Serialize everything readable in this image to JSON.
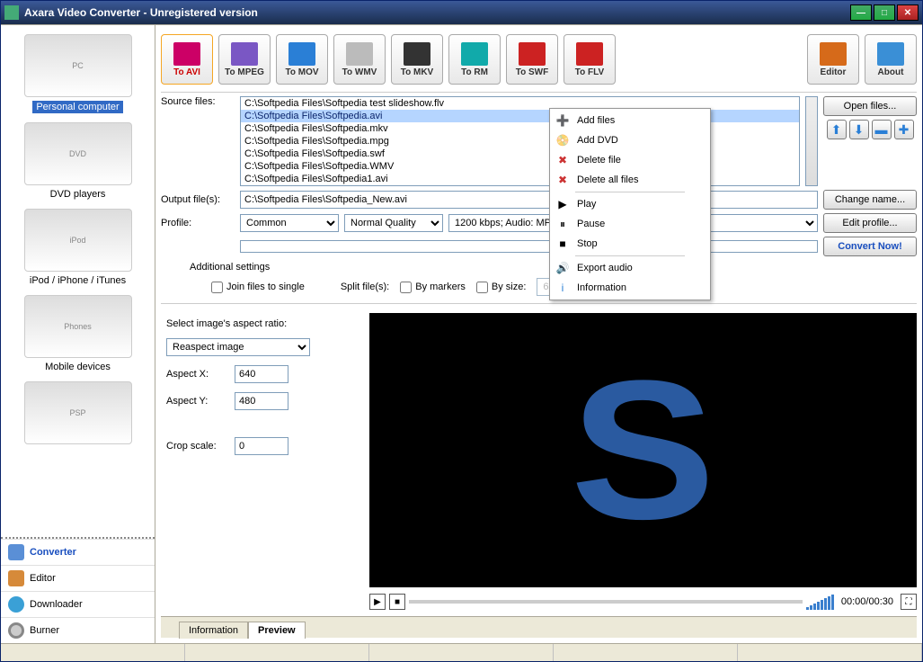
{
  "window": {
    "title": "Axara Video Converter - Unregistered version"
  },
  "devices": [
    {
      "label": "Personal computer",
      "hint": "PC",
      "selected": true
    },
    {
      "label": "DVD players",
      "hint": "DVD"
    },
    {
      "label": "iPod / iPhone / iTunes",
      "hint": "iPod"
    },
    {
      "label": "Mobile devices",
      "hint": "Phones"
    },
    {
      "label": "",
      "hint": "PSP"
    }
  ],
  "sidenav": [
    {
      "label": "Converter",
      "cls": "converter",
      "current": true
    },
    {
      "label": "Editor",
      "cls": "editor"
    },
    {
      "label": "Downloader",
      "cls": "downloader"
    },
    {
      "label": "Burner",
      "cls": "burner"
    }
  ],
  "toolbar": [
    {
      "label": "To AVI",
      "color": "#c06",
      "active": true
    },
    {
      "label": "To MPEG",
      "color": "#7a57c4"
    },
    {
      "label": "To MOV",
      "color": "#2a7fd6"
    },
    {
      "label": "To WMV",
      "color": "linear"
    },
    {
      "label": "To MKV",
      "color": "#333"
    },
    {
      "label": "To RM",
      "color": "#1aa"
    },
    {
      "label": "To SWF",
      "color": "#c22"
    },
    {
      "label": "To FLV",
      "color": "#c22"
    }
  ],
  "right_toolbar": [
    {
      "label": "Editor"
    },
    {
      "label": "About"
    }
  ],
  "labels": {
    "source_files": "Source files:",
    "output_files": "Output file(s):",
    "profile": "Profile:",
    "additional_settings": "Additional settings",
    "join": "Join files to single",
    "split": "Split file(s):",
    "by_markers": "By markers",
    "by_size": "By size:",
    "select_aspect": "Select image's aspect ratio:",
    "aspect_x": "Aspect X:",
    "aspect_y": "Aspect Y:",
    "crop_scale": "Crop scale:"
  },
  "files": [
    {
      "path": "C:\\Softpedia Files\\Softpedia test slideshow.flv"
    },
    {
      "path": "C:\\Softpedia Files\\Softpedia.avi",
      "selected": true
    },
    {
      "path": "C:\\Softpedia Files\\Softpedia.mkv"
    },
    {
      "path": "C:\\Softpedia Files\\Softpedia.mpg"
    },
    {
      "path": "C:\\Softpedia Files\\Softpedia.swf"
    },
    {
      "path": "C:\\Softpedia Files\\Softpedia.WMV"
    },
    {
      "path": "C:\\Softpedia Files\\Softpedia1.avi"
    }
  ],
  "output_file": "C:\\Softpedia Files\\Softpedia_New.avi",
  "profile": {
    "preset": "Common",
    "quality": "Normal Quality",
    "codec": "1200 kbps; Audio: MP3 - 128 kbps"
  },
  "split_size": "690 Mb",
  "aspect": {
    "mode": "Reaspect image",
    "x": "640",
    "y": "480",
    "crop": "0"
  },
  "buttons": {
    "open_files": "Open files...",
    "change_name": "Change name...",
    "edit_profile": "Edit profile...",
    "convert": "Convert Now!"
  },
  "context_menu": [
    {
      "label": "Add files",
      "icon": "➕",
      "color": "#3a3"
    },
    {
      "label": "Add DVD",
      "icon": "📀",
      "color": "#cc9"
    },
    {
      "label": "Delete file",
      "icon": "✖",
      "color": "#c33",
      "sep_after": false
    },
    {
      "label": "Delete all files",
      "icon": "✖",
      "color": "#c33",
      "sep_after": true
    },
    {
      "label": "Play",
      "icon": "▶",
      "color": "#000"
    },
    {
      "label": "Pause",
      "icon": "⏸",
      "color": "#000"
    },
    {
      "label": "Stop",
      "icon": "■",
      "color": "#000",
      "sep_after": true
    },
    {
      "label": "Export audio",
      "icon": "🔊",
      "color": "#2a7fd6"
    },
    {
      "label": "Information",
      "icon": "i",
      "color": "#2a7fd6"
    }
  ],
  "tabs": [
    {
      "label": "Information"
    },
    {
      "label": "Preview",
      "active": true
    }
  ],
  "time": "00:00/00:30"
}
